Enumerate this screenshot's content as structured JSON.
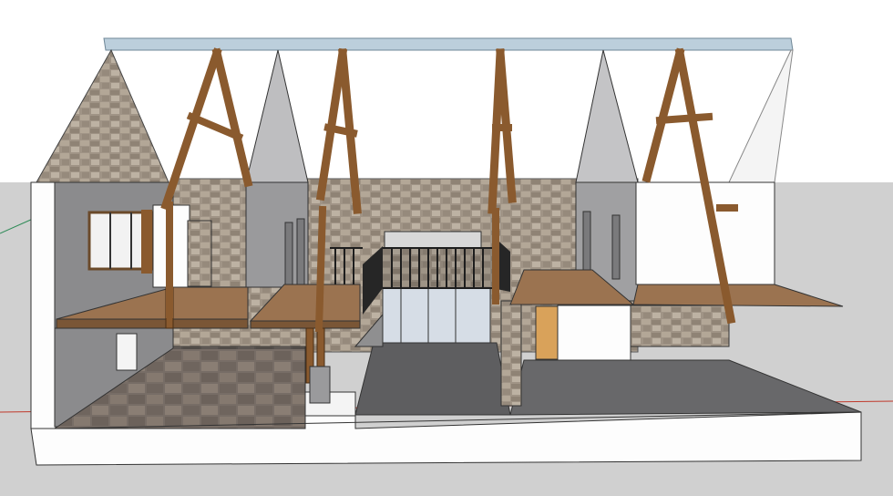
{
  "scene": {
    "view": "section-perspective",
    "colors": {
      "sky": "#ffffff",
      "ground": "#cfcfcf",
      "wall_white": "#fdfdfd",
      "wall_grey": "#8a8a8c",
      "wall_grey_light": "#b6b6b8",
      "stone": "#a09486",
      "timber": "#8a5a2e",
      "timber_dark": "#5e3b1c",
      "floor_timber": "#9b7350",
      "floor_tile": "#7a7068",
      "floor_dark": "#5e5e60",
      "glass": "#cfd8e3",
      "roof_ridge": "#bccfdc",
      "railing": "#202020",
      "door": "#d9a25a",
      "axis_red": "#c0392b",
      "axis_green": "#2e8b57"
    }
  }
}
